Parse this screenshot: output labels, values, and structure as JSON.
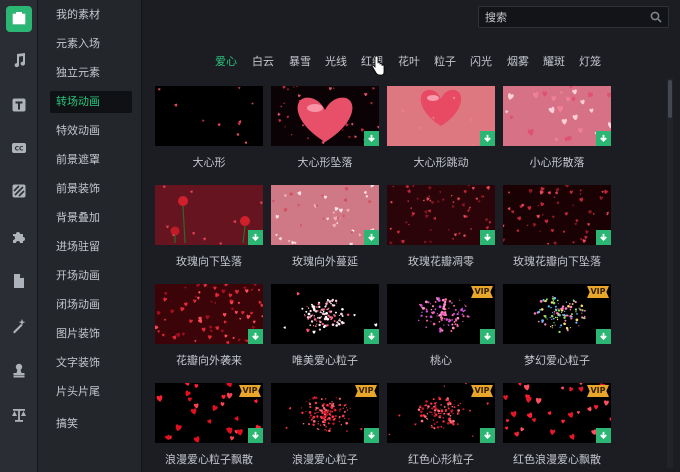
{
  "rail": {
    "items": [
      {
        "icon": "film-frame-icon"
      },
      {
        "icon": "music-note-icon"
      },
      {
        "icon": "text-icon"
      },
      {
        "icon": "caption-icon"
      },
      {
        "icon": "filter-icon"
      },
      {
        "icon": "puzzle-icon"
      },
      {
        "icon": "folder-icon"
      },
      {
        "icon": "magic-wand-icon"
      },
      {
        "icon": "stamp-icon"
      },
      {
        "icon": "balance-icon"
      }
    ]
  },
  "sidebar": {
    "items": [
      {
        "label": "我的素材"
      },
      {
        "label": "元素入场"
      },
      {
        "label": "独立元素"
      },
      {
        "label": "转场动画"
      },
      {
        "label": "特效动画"
      },
      {
        "label": "前景遮罩"
      },
      {
        "label": "前景装饰"
      },
      {
        "label": "背景叠加"
      },
      {
        "label": "进场驻留"
      },
      {
        "label": "开场动画"
      },
      {
        "label": "闭场动画"
      },
      {
        "label": "图片装饰"
      },
      {
        "label": "文字装饰"
      },
      {
        "label": "片头片尾"
      },
      {
        "label": "搞笑"
      }
    ],
    "active_index": 3
  },
  "search": {
    "placeholder": "搜索"
  },
  "tabs": [
    "爱心",
    "白云",
    "暴雪",
    "光线",
    "红绸",
    "花叶",
    "粒子",
    "闪光",
    "烟雾",
    "耀斑",
    "灯笼"
  ],
  "active_tab": 0,
  "items": [
    {
      "label": "大心形",
      "vip": "",
      "download": false,
      "style": "sparse"
    },
    {
      "label": "大心形坠落",
      "vip": "",
      "download": true,
      "style": "bigheart-dark"
    },
    {
      "label": "大心形跳动",
      "vip": "",
      "download": true,
      "style": "bigheart-pink"
    },
    {
      "label": "小心形散落",
      "vip": "",
      "download": true,
      "style": "pink-scatter"
    },
    {
      "label": "玫瑰向下坠落",
      "vip": "",
      "download": true,
      "style": "roses"
    },
    {
      "label": "玫瑰向外蔓延",
      "vip": "",
      "download": true,
      "style": "petals-pink"
    },
    {
      "label": "玫瑰花瓣凋零",
      "vip": "",
      "download": true,
      "style": "petals-dark"
    },
    {
      "label": "玫瑰花瓣向下坠落",
      "vip": "",
      "download": true,
      "style": "petals-dark2"
    },
    {
      "label": "花瓣向外袭来",
      "vip": "",
      "download": true,
      "style": "petals-red"
    },
    {
      "label": "唯美爱心粒子",
      "vip": "",
      "download": true,
      "style": "white-particles"
    },
    {
      "label": "桃心",
      "vip": "VIP",
      "download": true,
      "style": "pink-particles"
    },
    {
      "label": "梦幻爱心粒子",
      "vip": "VIP",
      "download": true,
      "style": "green-particles"
    },
    {
      "label": "浪漫爱心粒子飘散",
      "vip": "VIP",
      "download": true,
      "style": "red-hearts"
    },
    {
      "label": "浪漫爱心粒子",
      "vip": "VIP",
      "download": true,
      "style": "red-burst"
    },
    {
      "label": "红色心形粒子",
      "vip": "VIP",
      "download": true,
      "style": "red-small"
    },
    {
      "label": "红色浪漫爱心飘散",
      "vip": "VIP",
      "download": true,
      "style": "red-hearts2"
    }
  ],
  "colors": {
    "accent": "#2bc47d",
    "vip": "#e8a62a",
    "download": "#2bb673"
  }
}
